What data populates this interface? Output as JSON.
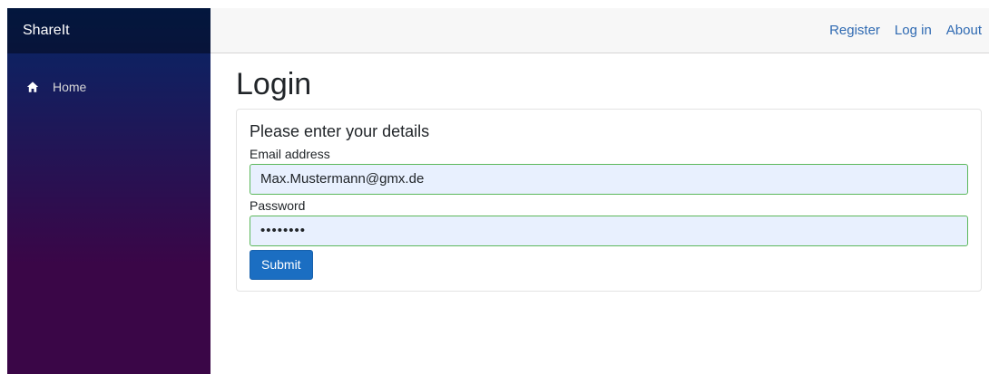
{
  "sidebar": {
    "brand": "ShareIt",
    "items": [
      {
        "label": "Home",
        "icon": "home-icon"
      }
    ]
  },
  "topbar": {
    "links": [
      "Register",
      "Log in",
      "About"
    ]
  },
  "page": {
    "title": "Login",
    "card_heading": "Please enter your details",
    "email_label": "Email address",
    "email_value": "Max.Mustermann@gmx.de",
    "password_label": "Password",
    "password_value": "12345678",
    "submit_label": "Submit"
  },
  "colors": {
    "link": "#2f6ab2",
    "button": "#1b6ec2",
    "input_border": "#5cb85c",
    "input_bg": "#e8f0fe"
  }
}
